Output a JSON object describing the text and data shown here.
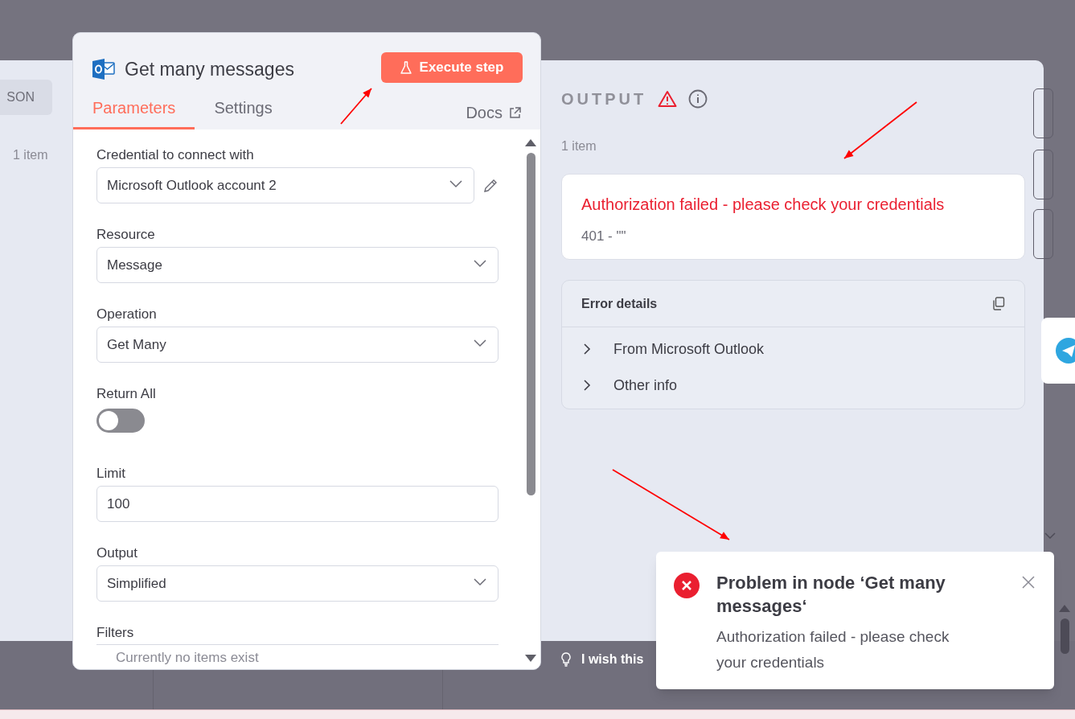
{
  "background": {
    "json_button": "SON",
    "input_count": "1 item",
    "feedback_text": "I wish this"
  },
  "node": {
    "title": "Get many messages",
    "execute_button": "Execute step",
    "tabs": [
      {
        "label": "Parameters",
        "selected": true
      },
      {
        "label": "Settings",
        "selected": false
      }
    ],
    "docs_link": "Docs",
    "fields": [
      {
        "kind": "credential",
        "label": "Credential to connect with",
        "value": "Microsoft Outlook account 2"
      },
      {
        "kind": "select",
        "label": "Resource",
        "value": "Message"
      },
      {
        "kind": "select",
        "label": "Operation",
        "value": "Get Many"
      },
      {
        "kind": "toggle",
        "label": "Return All",
        "on": false
      },
      {
        "kind": "input",
        "label": "Limit",
        "value": "100"
      },
      {
        "kind": "select",
        "label": "Output",
        "value": "Simplified"
      },
      {
        "kind": "collection",
        "label": "Filters",
        "empty_text": "Currently no items exist"
      }
    ]
  },
  "output": {
    "title": "OUTPUT",
    "count": "1 item",
    "error": {
      "message": "Authorization failed - please check your credentials",
      "description": "401 - \"\""
    },
    "details": {
      "title": "Error details",
      "sections": [
        {
          "label": "From Microsoft Outlook",
          "expanded": false
        },
        {
          "label": "Other info",
          "expanded": false
        }
      ]
    }
  },
  "toast": {
    "title": "Problem in node ‘Get many messages‘",
    "message": "Authorization failed - please check your credentials"
  }
}
